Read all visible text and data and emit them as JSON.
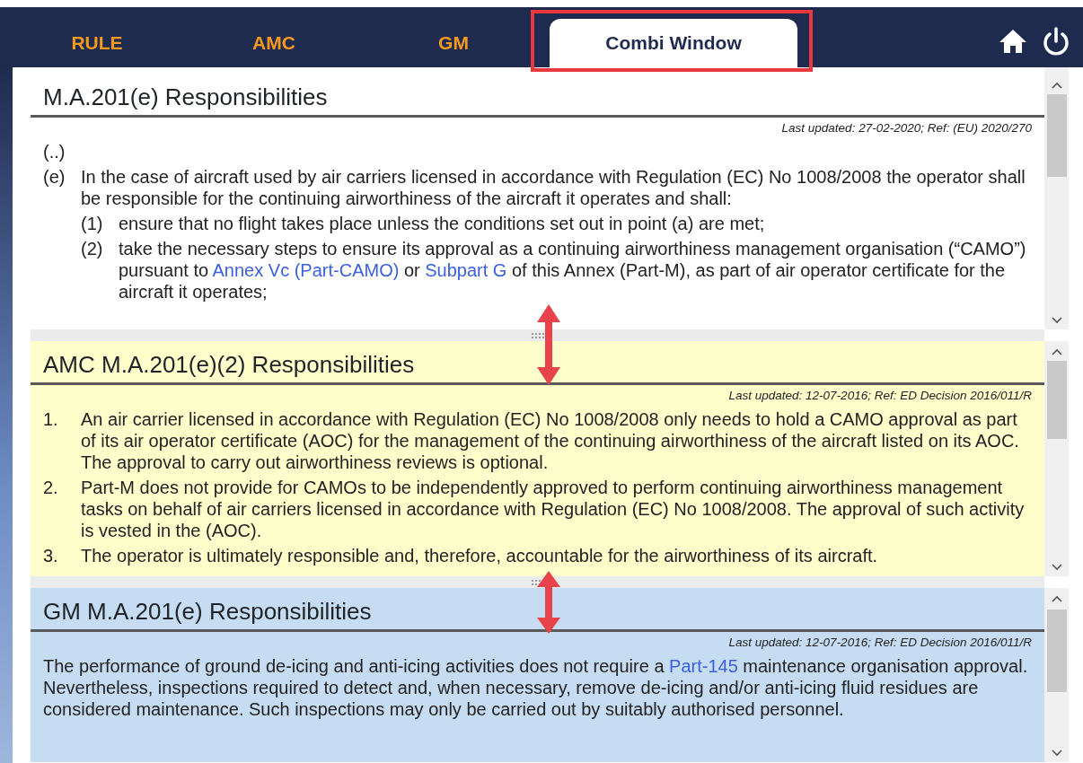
{
  "tabs": [
    {
      "label": "RULE",
      "selected": false
    },
    {
      "label": "AMC",
      "selected": false
    },
    {
      "label": "GM",
      "selected": false
    },
    {
      "label": "Combi Window",
      "selected": true
    }
  ],
  "panels": [
    {
      "title": "M.A.201(e) Responsibilities",
      "color": "#ffffff",
      "last_updated": "Last updated: 27-02-2020; Ref: (EU) 2020/270",
      "items": [
        {
          "marker": "",
          "segments": [
            {
              "kind": "text",
              "text": "(..)"
            }
          ]
        },
        {
          "marker": "(e)",
          "segments": [
            {
              "kind": "text",
              "text": "In the case of aircraft used by air carriers licensed in accordance with Regulation (EC) No 1008/2008 the operator shall be responsible for the continuing airworthiness of the aircraft it operates and shall:"
            }
          ],
          "children": [
            {
              "marker": "(1)",
              "segments": [
                {
                  "kind": "text",
                  "text": "ensure that no flight takes place unless the conditions set out in point (a) are met;"
                }
              ]
            },
            {
              "marker": "(2)",
              "segments": [
                {
                  "kind": "text",
                  "text": "take the necessary steps to ensure its approval as a continuing airworthiness management organisation (“CAMO”) pursuant to "
                },
                {
                  "kind": "link",
                  "text": "Annex Vc (Part-CAMO)"
                },
                {
                  "kind": "text",
                  "text": " or "
                },
                {
                  "kind": "link",
                  "text": "Subpart G"
                },
                {
                  "kind": "text",
                  "text": " of this Annex (Part-M), as part of air operator certificate for the aircraft it operates;"
                }
              ]
            }
          ]
        }
      ]
    },
    {
      "title": "AMC M.A.201(e)(2) Responsibilities",
      "color": "#ffffcc",
      "last_updated": "Last updated: 12-07-2016; Ref: ED Decision 2016/011/R",
      "items": [
        {
          "marker": "1.",
          "segments": [
            {
              "kind": "text",
              "text": "An air carrier licensed in accordance with Regulation (EC) No 1008/2008 only needs to hold a CAMO approval as part of its air operator certificate (AOC) for the management of the continuing airworthiness of the aircraft listed on its AOC. The approval to carry out airworthiness reviews is optional."
            }
          ]
        },
        {
          "marker": "2.",
          "segments": [
            {
              "kind": "text",
              "text": "Part-M does not provide for CAMOs to be independently approved to perform continuing airworthiness management tasks on behalf of air carriers licensed in accordance with Regulation (EC) No 1008/2008. The approval of such activity is vested in the (AOC)."
            }
          ]
        },
        {
          "marker": "3.",
          "segments": [
            {
              "kind": "text",
              "text": "The operator is ultimately responsible and, therefore, accountable for the airworthiness of its aircraft."
            }
          ]
        }
      ]
    },
    {
      "title": "GM M.A.201(e) Responsibilities",
      "color": "#c5dcf2",
      "last_updated": "Last updated: 12-07-2016; Ref: ED Decision 2016/011/R",
      "items": [
        {
          "marker": "",
          "segments": [
            {
              "kind": "text",
              "text": "The performance of ground de-icing and anti-icing activities does not require a "
            },
            {
              "kind": "link",
              "text": "Part-145"
            },
            {
              "kind": "text",
              "text": " maintenance organisation approval. Nevertheless, inspections required to detect and, when necessary, remove de-icing and/or anti-icing fluid residues are considered maintenance. Such inspections may only be carried out by suitably authorised personnel."
            }
          ]
        }
      ]
    }
  ]
}
